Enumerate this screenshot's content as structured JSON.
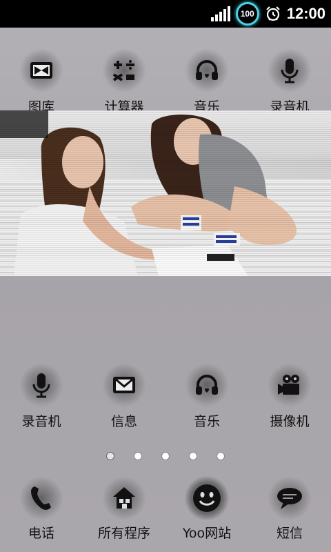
{
  "status_bar": {
    "battery": "100",
    "time": "12:00"
  },
  "top_row": [
    {
      "label": "图库",
      "icon": "gallery-icon"
    },
    {
      "label": "计算器",
      "icon": "calculator-icon"
    },
    {
      "label": "音乐",
      "icon": "headphones-icon"
    },
    {
      "label": "录音机",
      "icon": "microphone-icon"
    }
  ],
  "bottom_row": [
    {
      "label": "录音机",
      "icon": "microphone-icon"
    },
    {
      "label": "信息",
      "icon": "envelope-icon"
    },
    {
      "label": "音乐",
      "icon": "headphones-icon"
    },
    {
      "label": "摄像机",
      "icon": "video-camera-icon"
    }
  ],
  "page_indicator": {
    "count": 5,
    "active": 0
  },
  "dock": [
    {
      "label": "电话",
      "icon": "phone-icon"
    },
    {
      "label": "所有程序",
      "icon": "home-icon"
    },
    {
      "label": "Yoo网站",
      "icon": "smiley-icon"
    },
    {
      "label": "短信",
      "icon": "speech-bubble-icon"
    }
  ],
  "colors": {
    "background": "#a9a6ab",
    "battery_ring": "#4fd1e6",
    "status_bar": "#000000"
  }
}
